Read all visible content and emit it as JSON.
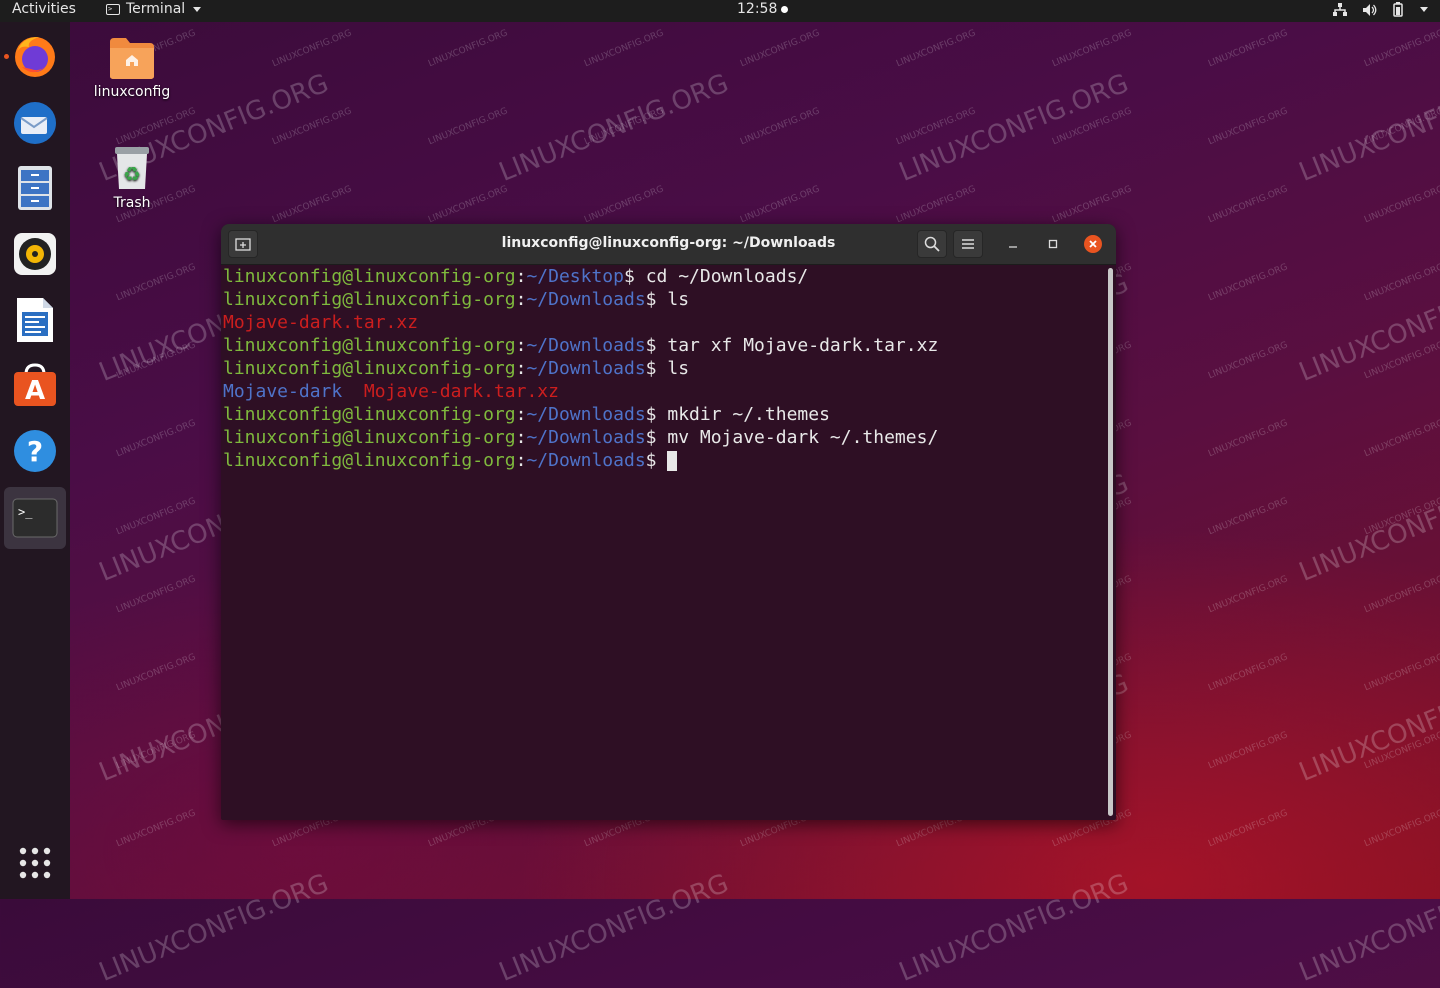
{
  "topbar": {
    "activities": "Activities",
    "app_name": "Terminal",
    "clock": "12:58"
  },
  "desktop": {
    "icons": [
      {
        "label": "linuxconfig"
      },
      {
        "label": "Trash"
      }
    ],
    "watermark": "LINUXCONFIG.ORG"
  },
  "dock": {
    "items": [
      "firefox-icon",
      "thunderbird-icon",
      "files-icon",
      "rhythmbox-icon",
      "writer-icon",
      "software-icon",
      "help-icon",
      "terminal-icon"
    ],
    "show_apps": "show-applications-icon"
  },
  "terminal": {
    "title": "linuxconfig@linuxconfig-org: ~/Downloads",
    "lines": [
      {
        "user": "linuxconfig@linuxconfig-org",
        "sep": ":",
        "path": "~/Desktop",
        "prompt": "$ ",
        "cmd": "cd ~/Downloads/"
      },
      {
        "user": "linuxconfig@linuxconfig-org",
        "sep": ":",
        "path": "~/Downloads",
        "prompt": "$ ",
        "cmd": "ls"
      },
      {
        "out_red": "Mojave-dark.tar.xz"
      },
      {
        "user": "linuxconfig@linuxconfig-org",
        "sep": ":",
        "path": "~/Downloads",
        "prompt": "$ ",
        "cmd": "tar xf Mojave-dark.tar.xz"
      },
      {
        "user": "linuxconfig@linuxconfig-org",
        "sep": ":",
        "path": "~/Downloads",
        "prompt": "$ ",
        "cmd": "ls"
      },
      {
        "out_dir": "Mojave-dark",
        "out_red": "Mojave-dark.tar.xz"
      },
      {
        "user": "linuxconfig@linuxconfig-org",
        "sep": ":",
        "path": "~/Downloads",
        "prompt": "$ ",
        "cmd": "mkdir ~/.themes"
      },
      {
        "user": "linuxconfig@linuxconfig-org",
        "sep": ":",
        "path": "~/Downloads",
        "prompt": "$ ",
        "cmd": "mv Mojave-dark ~/.themes/"
      },
      {
        "user": "linuxconfig@linuxconfig-org",
        "sep": ":",
        "path": "~/Downloads",
        "prompt": "$ ",
        "cmd": ""
      }
    ]
  },
  "colors": {
    "accent": "#e95420",
    "user_green": "#7fb93d",
    "path_blue": "#4f73c9",
    "archive_red": "#cc1e1e"
  }
}
